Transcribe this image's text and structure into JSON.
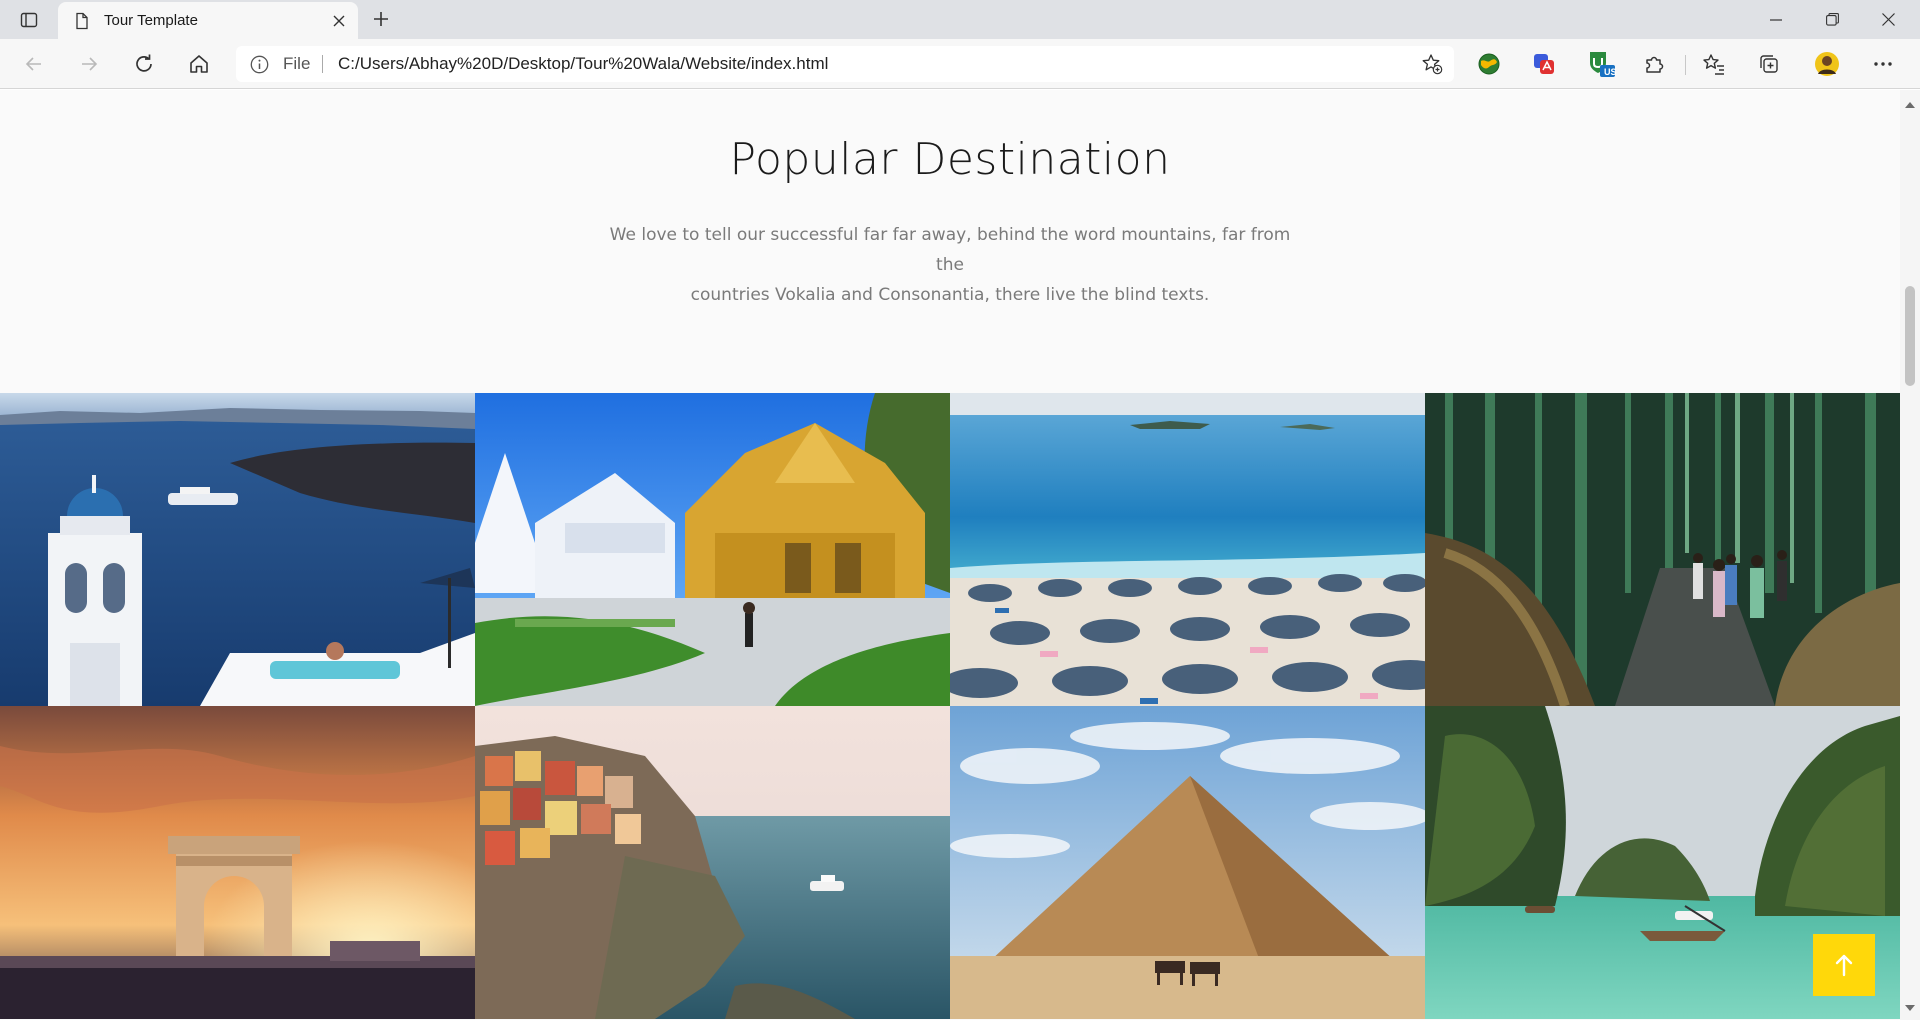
{
  "browser": {
    "tab_title": "Tour Template",
    "address_scheme_label": "File",
    "address_url": "C:/Users/Abhay%20D/Desktop/Tour%20Wala/Website/index.html",
    "extension_badge": "US"
  },
  "section": {
    "heading": "Popular Destination",
    "subtext_line1": "We love to tell our successful far far away, behind the word mountains, far from the",
    "subtext_line2": "countries Vokalia and Consonantia, there live the blind texts."
  },
  "destinations": [
    {
      "scene": "white-bell-tower-aegean-sea"
    },
    {
      "scene": "golden-white-temple"
    },
    {
      "scene": "beach-with-umbrellas"
    },
    {
      "scene": "bamboo-forest-path"
    },
    {
      "scene": "triumphal-arch-sunset"
    },
    {
      "scene": "colorful-cliffside-village"
    },
    {
      "scene": "desert-pyramid"
    },
    {
      "scene": "limestone-karst-lagoon"
    }
  ],
  "colors": {
    "accent": "#ffd80a",
    "page_bg": "#fafafa",
    "heading": "#1b1b1b",
    "subtext": "#7a7a7a"
  },
  "icons": {
    "back_to_top": "arrow-up-icon"
  }
}
